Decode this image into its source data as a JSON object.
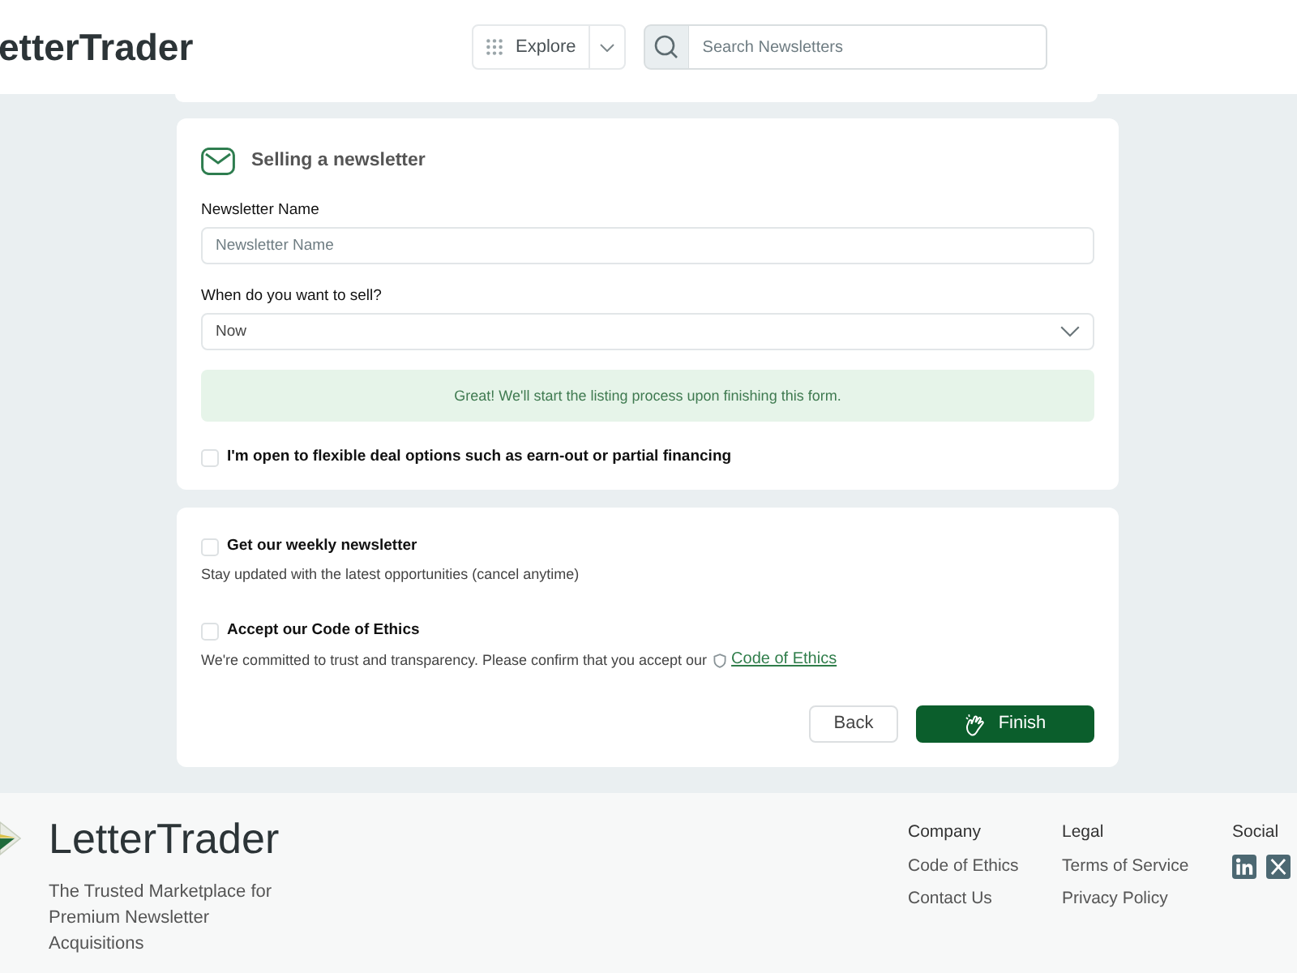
{
  "header": {
    "logo": "etterTrader",
    "explore": {
      "label": "Explore"
    },
    "search": {
      "placeholder": "Search Newsletters"
    }
  },
  "selling_form": {
    "title": "Selling a newsletter",
    "fields": [
      {
        "kind": "text",
        "label": "Newsletter Name",
        "placeholder": "Newsletter Name"
      },
      {
        "kind": "select",
        "label": "When do you want to sell?",
        "value": "Now"
      }
    ],
    "notice": "Great! We'll start the listing process upon finishing this form.",
    "options": [
      {
        "label": "I'm open to flexible deal options such as earn-out or partial financing",
        "checked": false
      }
    ]
  },
  "consents": {
    "options": [
      {
        "label": "Get our weekly newsletter",
        "checked": false,
        "description": "Stay updated with the latest opportunities (cancel anytime)"
      },
      {
        "label": "Accept our Code of Ethics",
        "checked": false,
        "description": "We're committed to trust and transparency. Please confirm that you accept our",
        "link": "Code of Ethics"
      }
    ],
    "buttons": [
      {
        "kind": "secondary",
        "label": "Back"
      },
      {
        "kind": "primary",
        "label": "Finish"
      }
    ]
  },
  "footer": {
    "logo": "LetterTrader",
    "tagline": "The Trusted Marketplace for Premium Newsletter Acquisitions",
    "columns": [
      {
        "kind": "links",
        "heading": "Company",
        "links": [
          "Code of Ethics",
          "Contact Us"
        ]
      },
      {
        "kind": "links",
        "heading": "Legal",
        "links": [
          "Terms of Service",
          "Privacy Policy"
        ]
      },
      {
        "kind": "social",
        "heading": "Social"
      }
    ]
  }
}
